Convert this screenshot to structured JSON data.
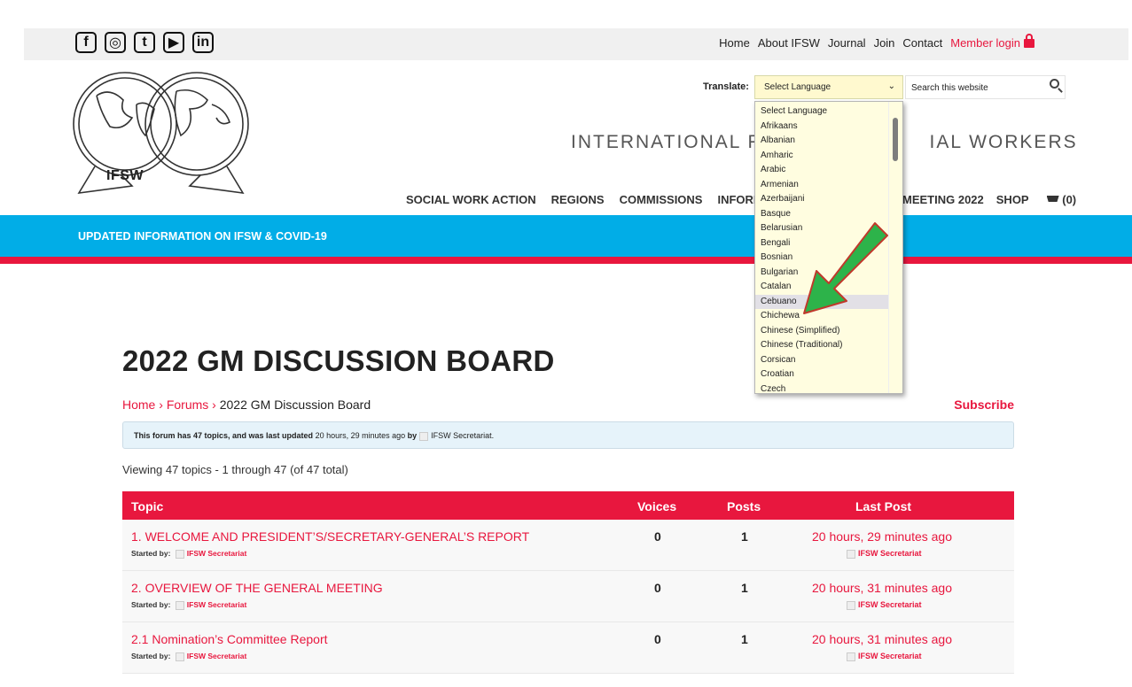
{
  "social": [
    "f",
    "◎",
    "t",
    "▶",
    "in"
  ],
  "social_names": [
    "facebook-icon",
    "instagram-icon",
    "twitter-icon",
    "youtube-icon",
    "linkedin-icon"
  ],
  "topnav": {
    "home": "Home",
    "about": "About IFSW",
    "journal": "Journal",
    "join": "Join",
    "contact": "Contact",
    "member": "Member login"
  },
  "logo_text": "IFSW",
  "translate": {
    "label": "Translate:",
    "selected": "Select Language"
  },
  "search": {
    "placeholder": "Search this website"
  },
  "tagline_left": "INTERNATIONAL FED",
  "tagline_right": "IAL WORKERS",
  "mainnav": {
    "items": [
      "SOCIAL WORK ACTION",
      "REGIONS",
      "COMMISSIONS",
      "INFORMATION"
    ],
    "meeting": "MEETING 2022",
    "shop": "SHOP",
    "cart_count": "(0)"
  },
  "banner": "UPDATED INFORMATION ON IFSW & COVID-19",
  "page_title": "2022 GM DISCUSSION BOARD",
  "breadcrumb": {
    "home": "Home",
    "sep": "›",
    "forums": "Forums",
    "current": "2022 GM Discussion Board"
  },
  "subscribe": "Subscribe",
  "notice": {
    "lead": "This forum has 47 topics, and was last updated",
    "time": "20 hours, 29 minutes ago",
    "by": "by",
    "user": "IFSW Secretariat."
  },
  "viewing": "Viewing 47 topics - 1 through 47 (of 47 total)",
  "table": {
    "headers": {
      "topic": "Topic",
      "voices": "Voices",
      "posts": "Posts",
      "last": "Last Post"
    },
    "started_by": "Started by:",
    "rows": [
      {
        "title": "1. WELCOME AND PRESIDENT’S/SECRETARY-GENERAL’S REPORT",
        "author": "IFSW Secretariat",
        "voices": "0",
        "posts": "1",
        "last": "20 hours, 29 minutes ago",
        "last_by": "IFSW Secretariat"
      },
      {
        "title": "2. OVERVIEW OF THE GENERAL MEETING",
        "author": "IFSW Secretariat",
        "voices": "0",
        "posts": "1",
        "last": "20 hours, 31 minutes ago",
        "last_by": "IFSW Secretariat"
      },
      {
        "title": "2.1 Nomination’s Committee Report",
        "author": "IFSW Secretariat",
        "voices": "0",
        "posts": "1",
        "last": "20 hours, 31 minutes ago",
        "last_by": "IFSW Secretariat"
      }
    ]
  },
  "languages": [
    "Select Language",
    "Afrikaans",
    "Albanian",
    "Amharic",
    "Arabic",
    "Armenian",
    "Azerbaijani",
    "Basque",
    "Belarusian",
    "Bengali",
    "Bosnian",
    "Bulgarian",
    "Catalan",
    "Cebuano",
    "Chichewa",
    "Chinese (Simplified)",
    "Chinese (Traditional)",
    "Corsican",
    "Croatian",
    "Czech"
  ],
  "highlighted_language": "Cebuano",
  "colors": {
    "accent_red": "#e8173e",
    "banner_blue": "#01ade7",
    "dropdown_bg": "#fffde0",
    "arrow_green": "#2db34a"
  }
}
